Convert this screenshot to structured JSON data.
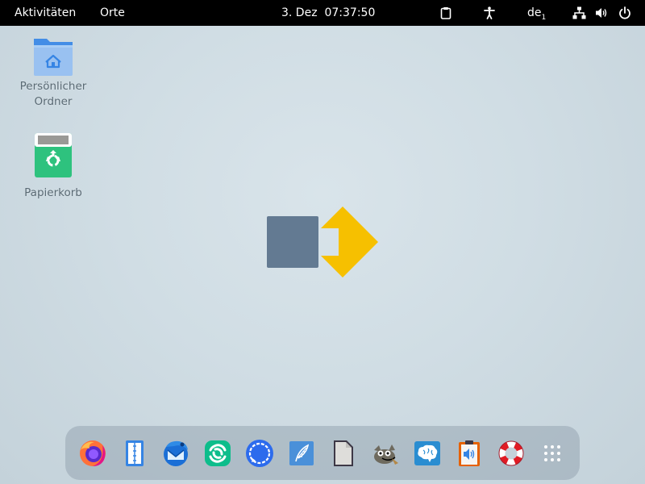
{
  "topbar": {
    "activities_label": "Aktivitäten",
    "places_label": "Orte",
    "date": "3. Dez",
    "time": "07:37:50",
    "keyboard_layout": "de",
    "keyboard_layout_index": "1",
    "icons": [
      "clipboard-icon",
      "accessibility-icon",
      "network-icon",
      "volume-icon",
      "power-icon"
    ]
  },
  "desktop": {
    "home_folder_label_line1": "Persönlicher",
    "home_folder_label_line2": "Ordner",
    "trash_label": "Papierkorb"
  },
  "dock": {
    "apps": [
      "firefox",
      "notes",
      "thunderbird",
      "element",
      "signal",
      "quill-writer",
      "text-editor",
      "gimp",
      "brain-app",
      "audio-clipboard",
      "help",
      "show-applications"
    ]
  },
  "colors": {
    "accent_blue": "#3584e4",
    "logo_gray": "#637a92",
    "logo_yellow": "#f6c000"
  }
}
